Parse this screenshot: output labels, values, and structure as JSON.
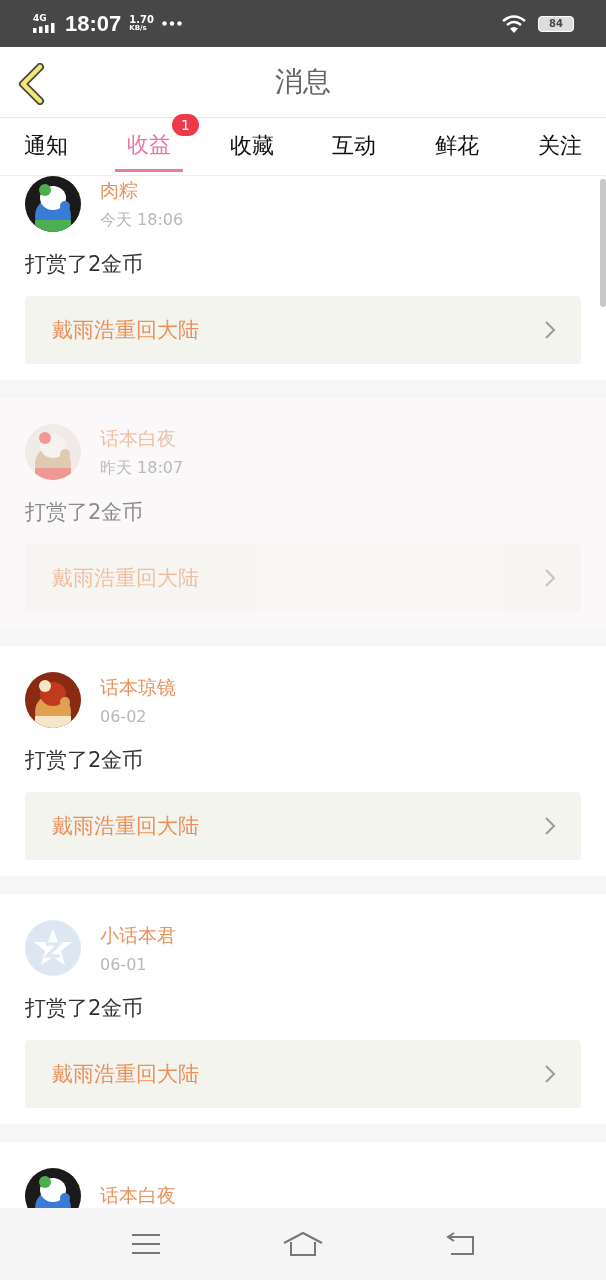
{
  "status_bar": {
    "network": "4G",
    "time": "18:07",
    "speed_value": "1.70",
    "speed_unit": "KB/s",
    "battery": "84"
  },
  "header": {
    "title": "消息"
  },
  "tabs": [
    {
      "label": "通知",
      "selected": false
    },
    {
      "label": "收益",
      "selected": true,
      "badge": "1"
    },
    {
      "label": "收藏",
      "selected": false
    },
    {
      "label": "互动",
      "selected": false
    },
    {
      "label": "鲜花",
      "selected": false
    },
    {
      "label": "关注",
      "selected": false
    }
  ],
  "messages": [
    {
      "user": "肉粽",
      "time": "今天 18:06",
      "text": "打赏了2金币",
      "book": "戴雨浩重回大陆",
      "faded": false
    },
    {
      "user": "话本白夜",
      "time": "昨天 18:07",
      "text": "打赏了2金币",
      "book": "戴雨浩重回大陆",
      "faded": true
    },
    {
      "user": "话本琼镜",
      "time": "06-02",
      "text": "打赏了2金币",
      "book": "戴雨浩重回大陆",
      "faded": false
    },
    {
      "user": "小话本君",
      "time": "06-01",
      "text": "打赏了2金币",
      "book": "戴雨浩重回大陆",
      "faded": false,
      "avatar": {
        "kind": "default"
      }
    },
    {
      "user": "话本白夜",
      "faded": false
    }
  ]
}
